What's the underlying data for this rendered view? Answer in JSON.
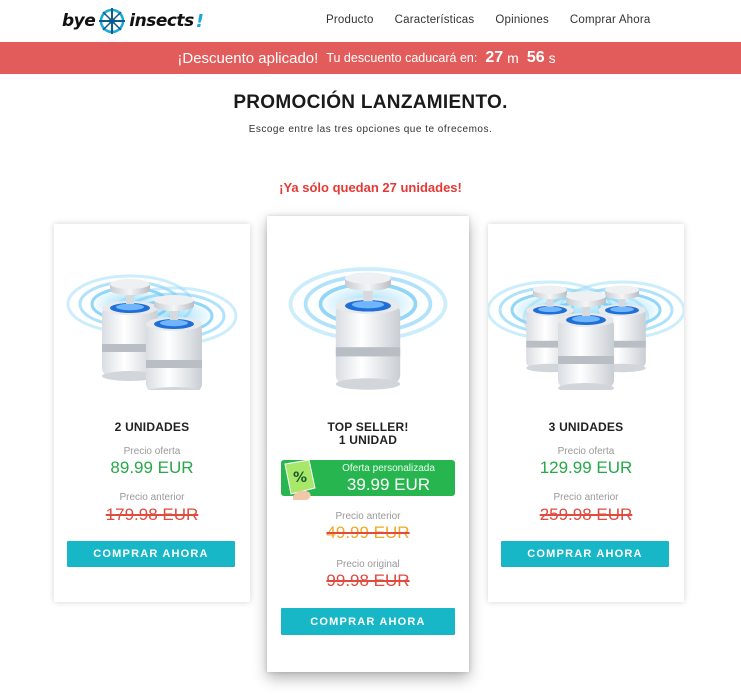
{
  "header": {
    "logo_text_1": "bye",
    "logo_text_2": "insects",
    "logo_bang": "!",
    "nav": [
      "Producto",
      "Características",
      "Opiniones",
      "Comprar Ahora"
    ]
  },
  "banner": {
    "discount": "¡Descuento aplicado!",
    "expires": "Tu descuento caducará en:",
    "minutes": "27",
    "minutes_unit": "m",
    "seconds": "56",
    "seconds_unit": "s"
  },
  "promo": {
    "title": "PROMOCIÓN LANZAMIENTO.",
    "subtitle": "Escoge entre las tres opciones que te ofrecemos.",
    "stock": "¡Ya sólo quedan 27 unidades!"
  },
  "cards": [
    {
      "title": "2 UNIDADES",
      "offer_label": "Precio oferta",
      "offer_price": "89.99 EUR",
      "previous_label": "Precio anterior",
      "previous_price": "179.98 EUR",
      "button": "COMPRAR AHORA"
    },
    {
      "title_line1": "TOP SELLER!",
      "title_line2": "1 UNIDAD",
      "custom_label": "Oferta personalizada",
      "custom_price": "39.99 EUR",
      "previous_label": "Precio anterior",
      "previous_price": "49.99 EUR",
      "original_label": "Precio original",
      "original_price": "99.98 EUR",
      "button": "COMPRAR AHORA"
    },
    {
      "title": "3 UNIDADES",
      "offer_label": "Precio oferta",
      "offer_price": "129.99 EUR",
      "previous_label": "Precio anterior",
      "previous_price": "259.98 EUR",
      "button": "COMPRAR AHORA"
    }
  ],
  "colors": {
    "banner": "#e35c5c",
    "button": "#17b7c7",
    "green": "#27a84a",
    "red": "#e53935"
  }
}
